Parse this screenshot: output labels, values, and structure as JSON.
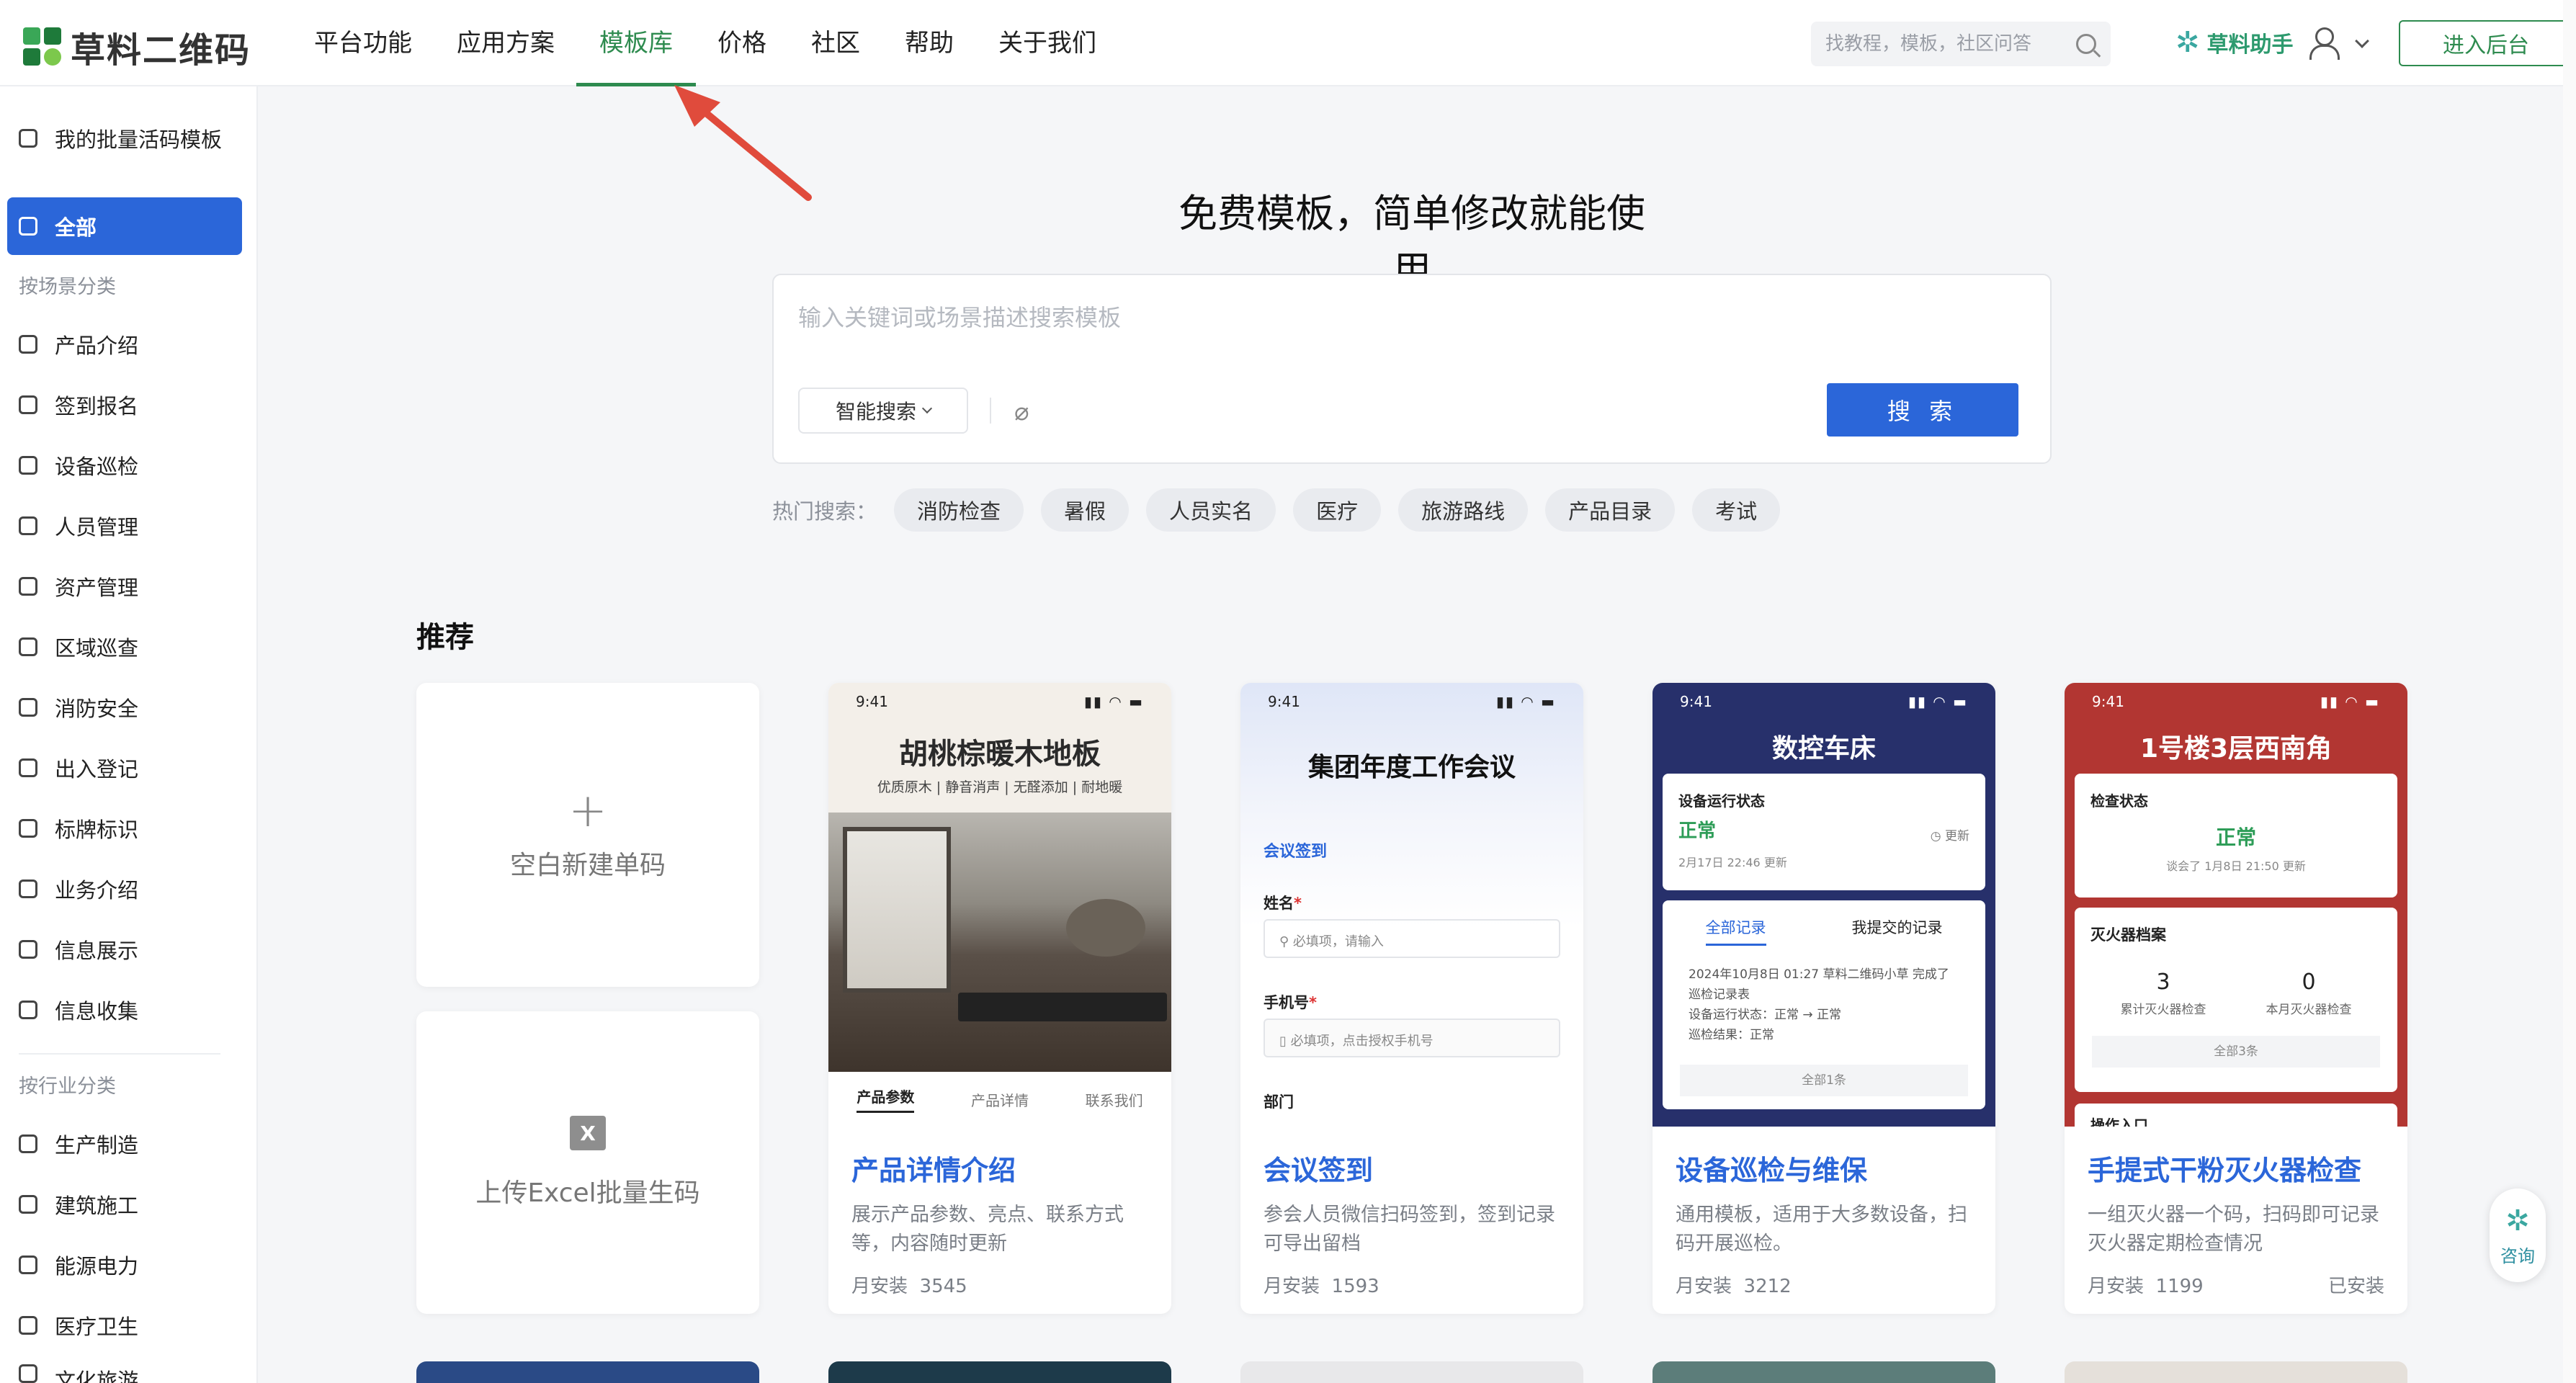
{
  "header": {
    "brand": "草料二维码",
    "nav": [
      "平台功能",
      "应用方案",
      "模板库",
      "价格",
      "社区",
      "帮助",
      "关于我们"
    ],
    "active_nav": "模板库",
    "search_placeholder": "找教程，模板，社区问答",
    "assistant_label": "草料助手",
    "enter_button": "进入后台"
  },
  "sidebar": {
    "my_templates": "我的批量活码模板",
    "all": "全部",
    "group_scene": "按场景分类",
    "scene_items": [
      "产品介绍",
      "签到报名",
      "设备巡检",
      "人员管理",
      "资产管理",
      "区域巡查",
      "消防安全",
      "出入登记",
      "标牌标识",
      "业务介绍",
      "信息展示",
      "信息收集"
    ],
    "group_industry": "按行业分类",
    "industry_items": [
      "生产制造",
      "建筑施工",
      "能源电力",
      "医疗卫生",
      "文化旅游"
    ]
  },
  "hero": {
    "title": "免费模板，简单修改就能使用",
    "search_placeholder": "输入关键词或场景描述搜索模板",
    "smart_search": "智能搜索",
    "search_button": "搜 索",
    "hot_label": "热门搜索：",
    "hot_tags": [
      "消防检查",
      "暑假",
      "人员实名",
      "医疗",
      "旅游路线",
      "产品目录",
      "考试"
    ]
  },
  "recommend": {
    "title": "推荐",
    "blank_new": "空白新建单码",
    "upload_excel": "上传Excel批量生码",
    "excel_glyph": "X",
    "cards": [
      {
        "name": "产品详情介绍",
        "desc": "展示产品参数、亮点、联系方式等，内容随时更新",
        "installs_label": "月安装",
        "installs": "3545",
        "installed": "",
        "preview": {
          "time": "9:41",
          "title": "胡桃棕暖木地板",
          "subtitle": "优质原木 | 静音消声 | 无醛添加 | 耐地暖",
          "tabs": [
            "产品参数",
            "产品详情",
            "联系我们"
          ]
        }
      },
      {
        "name": "会议签到",
        "desc": "参会人员微信扫码签到，签到记录可导出留档",
        "installs_label": "月安装",
        "installs": "1593",
        "installed": "",
        "preview": {
          "time": "9:41",
          "title": "集团年度工作会议",
          "section": "会议签到",
          "name_label": "姓名",
          "name_hint": "必填项，请输入",
          "phone_label": "手机号",
          "phone_hint": "必填项，点击授权手机号",
          "dept_label": "部门",
          "required_mark": "*"
        }
      },
      {
        "name": "设备巡检与维保",
        "desc": "通用模板，适用于大多数设备，扫码开展巡检。",
        "installs_label": "月安装",
        "installs": "3212",
        "installed": "",
        "preview": {
          "time": "9:41",
          "title": "数控车床",
          "status_title": "设备运行状态",
          "status": "正常",
          "status_time": "2月17日 22:46 更新",
          "refresh": "◷ 更新",
          "tab_all": "全部记录",
          "tab_mine": "我提交的记录",
          "log_line1": "2024年10月8日 01:27 草料二维码小草 完成了巡检记录表",
          "log_line2": "设备运行状态：正常 → 正常",
          "log_line3": "巡检结果：正常",
          "all_count": "全部1条"
        }
      },
      {
        "name": "手提式干粉灭火器检查",
        "desc": "一组灭火器一个码，扫码即可记录灭火器定期检查情况",
        "installs_label": "月安装",
        "installs": "1199",
        "installed": "已安装",
        "preview": {
          "time": "9:41",
          "title": "1号楼3层西南角",
          "status_title": "检查状态",
          "status": "正常",
          "status_time": "谈会了 1月8日 21:50 更新",
          "archive_title": "灭火器档案",
          "stat1_value": "3",
          "stat1_label": "累计灭火器检查",
          "stat2_value": "0",
          "stat2_label": "本月灭火器检查",
          "all_count": "全部3条",
          "entry": "操作入口"
        }
      }
    ]
  },
  "consult": {
    "label": "咨询"
  },
  "colors": {
    "brand_green": "#2e8b4f",
    "primary_blue": "#2b66d9",
    "card3_bg": "#27306b",
    "card4_bg": "#b23632",
    "annotation_arrow": "#e04b3c"
  }
}
